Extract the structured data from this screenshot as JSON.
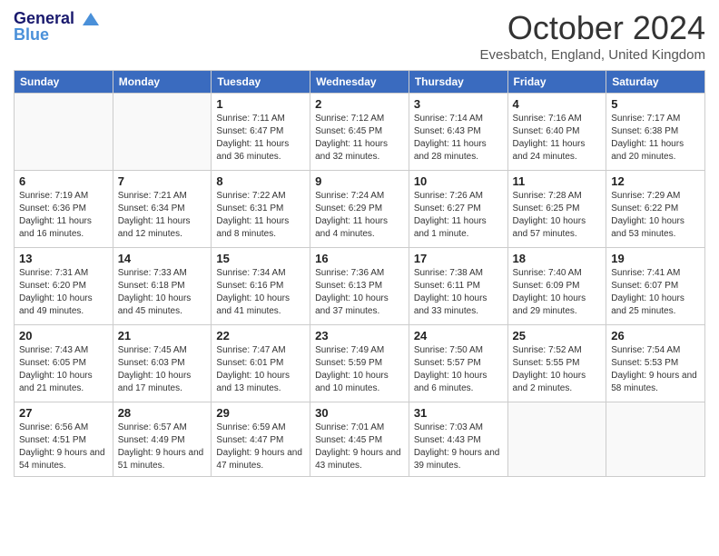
{
  "header": {
    "logo_line1": "General",
    "logo_line2": "Blue",
    "month": "October 2024",
    "location": "Evesbatch, England, United Kingdom"
  },
  "weekdays": [
    "Sunday",
    "Monday",
    "Tuesday",
    "Wednesday",
    "Thursday",
    "Friday",
    "Saturday"
  ],
  "weeks": [
    [
      {
        "date": "",
        "text": ""
      },
      {
        "date": "",
        "text": ""
      },
      {
        "date": "1",
        "text": "Sunrise: 7:11 AM\nSunset: 6:47 PM\nDaylight: 11 hours and 36 minutes."
      },
      {
        "date": "2",
        "text": "Sunrise: 7:12 AM\nSunset: 6:45 PM\nDaylight: 11 hours and 32 minutes."
      },
      {
        "date": "3",
        "text": "Sunrise: 7:14 AM\nSunset: 6:43 PM\nDaylight: 11 hours and 28 minutes."
      },
      {
        "date": "4",
        "text": "Sunrise: 7:16 AM\nSunset: 6:40 PM\nDaylight: 11 hours and 24 minutes."
      },
      {
        "date": "5",
        "text": "Sunrise: 7:17 AM\nSunset: 6:38 PM\nDaylight: 11 hours and 20 minutes."
      }
    ],
    [
      {
        "date": "6",
        "text": "Sunrise: 7:19 AM\nSunset: 6:36 PM\nDaylight: 11 hours and 16 minutes."
      },
      {
        "date": "7",
        "text": "Sunrise: 7:21 AM\nSunset: 6:34 PM\nDaylight: 11 hours and 12 minutes."
      },
      {
        "date": "8",
        "text": "Sunrise: 7:22 AM\nSunset: 6:31 PM\nDaylight: 11 hours and 8 minutes."
      },
      {
        "date": "9",
        "text": "Sunrise: 7:24 AM\nSunset: 6:29 PM\nDaylight: 11 hours and 4 minutes."
      },
      {
        "date": "10",
        "text": "Sunrise: 7:26 AM\nSunset: 6:27 PM\nDaylight: 11 hours and 1 minute."
      },
      {
        "date": "11",
        "text": "Sunrise: 7:28 AM\nSunset: 6:25 PM\nDaylight: 10 hours and 57 minutes."
      },
      {
        "date": "12",
        "text": "Sunrise: 7:29 AM\nSunset: 6:22 PM\nDaylight: 10 hours and 53 minutes."
      }
    ],
    [
      {
        "date": "13",
        "text": "Sunrise: 7:31 AM\nSunset: 6:20 PM\nDaylight: 10 hours and 49 minutes."
      },
      {
        "date": "14",
        "text": "Sunrise: 7:33 AM\nSunset: 6:18 PM\nDaylight: 10 hours and 45 minutes."
      },
      {
        "date": "15",
        "text": "Sunrise: 7:34 AM\nSunset: 6:16 PM\nDaylight: 10 hours and 41 minutes."
      },
      {
        "date": "16",
        "text": "Sunrise: 7:36 AM\nSunset: 6:13 PM\nDaylight: 10 hours and 37 minutes."
      },
      {
        "date": "17",
        "text": "Sunrise: 7:38 AM\nSunset: 6:11 PM\nDaylight: 10 hours and 33 minutes."
      },
      {
        "date": "18",
        "text": "Sunrise: 7:40 AM\nSunset: 6:09 PM\nDaylight: 10 hours and 29 minutes."
      },
      {
        "date": "19",
        "text": "Sunrise: 7:41 AM\nSunset: 6:07 PM\nDaylight: 10 hours and 25 minutes."
      }
    ],
    [
      {
        "date": "20",
        "text": "Sunrise: 7:43 AM\nSunset: 6:05 PM\nDaylight: 10 hours and 21 minutes."
      },
      {
        "date": "21",
        "text": "Sunrise: 7:45 AM\nSunset: 6:03 PM\nDaylight: 10 hours and 17 minutes."
      },
      {
        "date": "22",
        "text": "Sunrise: 7:47 AM\nSunset: 6:01 PM\nDaylight: 10 hours and 13 minutes."
      },
      {
        "date": "23",
        "text": "Sunrise: 7:49 AM\nSunset: 5:59 PM\nDaylight: 10 hours and 10 minutes."
      },
      {
        "date": "24",
        "text": "Sunrise: 7:50 AM\nSunset: 5:57 PM\nDaylight: 10 hours and 6 minutes."
      },
      {
        "date": "25",
        "text": "Sunrise: 7:52 AM\nSunset: 5:55 PM\nDaylight: 10 hours and 2 minutes."
      },
      {
        "date": "26",
        "text": "Sunrise: 7:54 AM\nSunset: 5:53 PM\nDaylight: 9 hours and 58 minutes."
      }
    ],
    [
      {
        "date": "27",
        "text": "Sunrise: 6:56 AM\nSunset: 4:51 PM\nDaylight: 9 hours and 54 minutes."
      },
      {
        "date": "28",
        "text": "Sunrise: 6:57 AM\nSunset: 4:49 PM\nDaylight: 9 hours and 51 minutes."
      },
      {
        "date": "29",
        "text": "Sunrise: 6:59 AM\nSunset: 4:47 PM\nDaylight: 9 hours and 47 minutes."
      },
      {
        "date": "30",
        "text": "Sunrise: 7:01 AM\nSunset: 4:45 PM\nDaylight: 9 hours and 43 minutes."
      },
      {
        "date": "31",
        "text": "Sunrise: 7:03 AM\nSunset: 4:43 PM\nDaylight: 9 hours and 39 minutes."
      },
      {
        "date": "",
        "text": ""
      },
      {
        "date": "",
        "text": ""
      }
    ]
  ]
}
